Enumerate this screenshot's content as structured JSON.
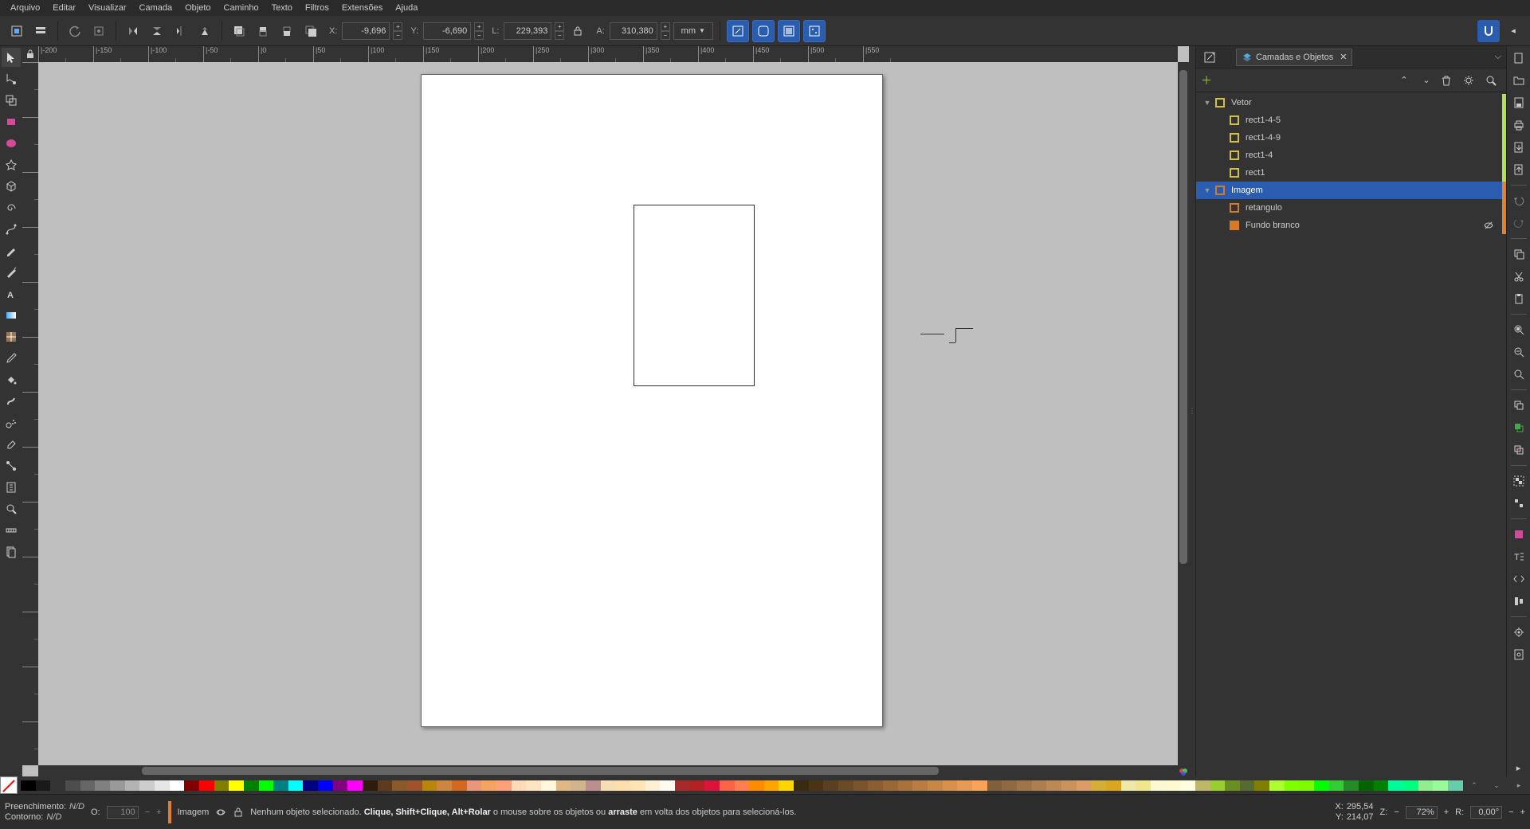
{
  "menu": [
    "Arquivo",
    "Editar",
    "Visualizar",
    "Camada",
    "Objeto",
    "Caminho",
    "Texto",
    "Filtros",
    "Extensões",
    "Ajuda"
  ],
  "toolbar": {
    "x_label": "X:",
    "x_value": "-9,696",
    "y_label": "Y:",
    "y_value": "-6,690",
    "w_label": "L:",
    "w_value": "229,393",
    "h_label": "A:",
    "h_value": "310,380",
    "unit": "mm"
  },
  "ruler_top": [
    "|-200",
    "|-150",
    "|-100",
    "|-50",
    "|0",
    "|50",
    "|100",
    "|150",
    "|200",
    "|250",
    "|300",
    "|350",
    "|400",
    "|450",
    "|500",
    "|550"
  ],
  "ruler_left": [
    "",
    "",
    "",
    "",
    "",
    "",
    "",
    "",
    "",
    "",
    "",
    "",
    "",
    ""
  ],
  "panel": {
    "tab_title": "Camadas e Objetos",
    "layers": [
      {
        "indent": 0,
        "toggle": "▼",
        "color": "yellow",
        "name": "Vetor",
        "stripe": "lime",
        "selected": false,
        "vis": ""
      },
      {
        "indent": 1,
        "toggle": "",
        "color": "yellow",
        "name": "rect1-4-5",
        "stripe": "lime",
        "selected": false,
        "vis": ""
      },
      {
        "indent": 1,
        "toggle": "",
        "color": "yellow",
        "name": "rect1-4-9",
        "stripe": "lime",
        "selected": false,
        "vis": ""
      },
      {
        "indent": 1,
        "toggle": "",
        "color": "yellow",
        "name": "rect1-4",
        "stripe": "lime",
        "selected": false,
        "vis": ""
      },
      {
        "indent": 1,
        "toggle": "",
        "color": "yellow",
        "name": "rect1",
        "stripe": "lime",
        "selected": false,
        "vis": ""
      },
      {
        "indent": 0,
        "toggle": "▼",
        "color": "orange",
        "name": "Imagem",
        "stripe": "orange",
        "selected": true,
        "vis": ""
      },
      {
        "indent": 1,
        "toggle": "",
        "color": "orange",
        "name": "retangulo",
        "stripe": "orange",
        "selected": false,
        "vis": ""
      },
      {
        "indent": 1,
        "toggle": "",
        "color": "orange-fill",
        "name": "Fundo branco",
        "stripe": "orange",
        "selected": false,
        "vis": "hidden"
      }
    ]
  },
  "status": {
    "fill_label": "Preenchimento:",
    "stroke_label": "Contorno:",
    "nd": "N/D",
    "o_label": "O:",
    "o_value": "100",
    "layer_name": "Imagem",
    "msg_pre": "Nenhum objeto selecionado. ",
    "msg_bold": "Clique, Shift+Clique, Alt+Rolar",
    "msg_mid": " o mouse sobre os objetos ou ",
    "msg_bold2": "arraste",
    "msg_post": " em volta dos objetos para selecioná-los.",
    "x_label": "X:",
    "x_val": "295,54",
    "y_label": "Y:",
    "y_val": "214,07",
    "z_label": "Z:",
    "z_val": "72%",
    "r_label": "R:",
    "r_val": "0,00°"
  },
  "palette": [
    "#000000",
    "#1a1a1a",
    "#333333",
    "#4d4d4d",
    "#666666",
    "#808080",
    "#999999",
    "#b3b3b3",
    "#cccccc",
    "#e6e6e6",
    "#ffffff",
    "#800000",
    "#ff0000",
    "#808000",
    "#ffff00",
    "#008000",
    "#00ff00",
    "#008080",
    "#00ffff",
    "#000080",
    "#0000ff",
    "#800080",
    "#ff00ff",
    "#2f1b0c",
    "#5e3a1e",
    "#8b5a2b",
    "#a0522d",
    "#b8860b",
    "#cd853f",
    "#d2691e",
    "#e9967a",
    "#f4a460",
    "#ffa07a",
    "#ffdab9",
    "#ffe4c4",
    "#fff8dc",
    "#deb887",
    "#d2b48c",
    "#bc8f8f",
    "#f5deb3",
    "#ffdead",
    "#ffe4b5",
    "#ffefd5",
    "#fffaf0",
    "#a52a2a",
    "#b22222",
    "#dc143c",
    "#ff6347",
    "#ff7f50",
    "#ff8c00",
    "#ffa500",
    "#ffd700",
    "#3a2a10",
    "#4a3415",
    "#5a4020",
    "#6b4a26",
    "#7a542c",
    "#8a5e32",
    "#9a6837",
    "#a9723c",
    "#b97c42",
    "#c88647",
    "#d8904d",
    "#e79a53",
    "#f7a458",
    "#80603a",
    "#8f6a41",
    "#9e7448",
    "#ad7e4f",
    "#bc8856",
    "#cb925d",
    "#da9c64",
    "#d4af37",
    "#daa520",
    "#eee8aa",
    "#f0e68c",
    "#fafad2",
    "#fffacd",
    "#ffffe0",
    "#bdb76b",
    "#9acd32",
    "#6b8e23",
    "#556b2f",
    "#808000",
    "#adff2f",
    "#7fff00",
    "#7cfc00",
    "#00ff00",
    "#32cd32",
    "#228b22",
    "#006400",
    "#008000",
    "#00fa9a",
    "#00ff7f",
    "#90ee90",
    "#98fb98",
    "#66cdaa"
  ]
}
